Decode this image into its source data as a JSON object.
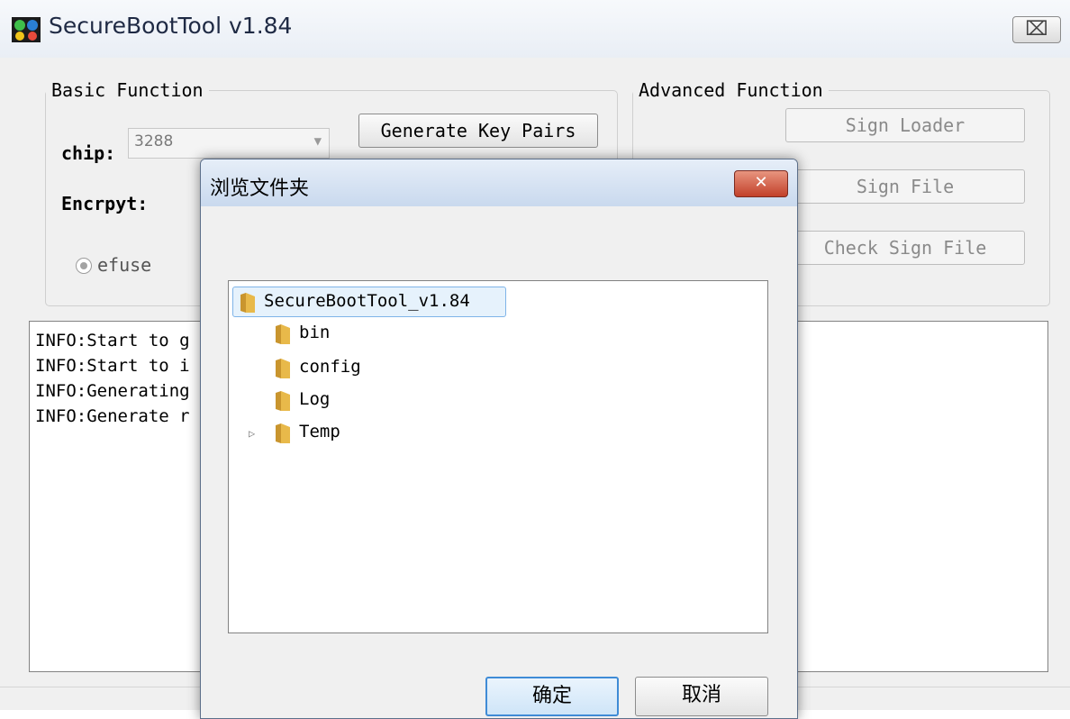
{
  "main_window": {
    "title": "SecureBootTool v1.84",
    "close_label": "⌧"
  },
  "basic": {
    "legend": "Basic Function",
    "chip_label": "chip:",
    "chip_value": "3288",
    "generate_label": "Generate Key Pairs",
    "encrypt_label": "Encrpyt:",
    "efuse_label": "efuse"
  },
  "advanced": {
    "legend": "Advanced Function",
    "sign_loader": "Sign Loader",
    "sign_file": "Sign File",
    "check_sign_file": "Check Sign File"
  },
  "log": {
    "lines": [
      "INFO:Start to g",
      "INFO:Start to i",
      "INFO:Generating",
      "INFO:Generate r"
    ]
  },
  "dialog": {
    "title": "浏览文件夹",
    "close_label": "✕",
    "tree": [
      {
        "label": "SecureBootTool_v1.84",
        "level": 0,
        "selected": true
      },
      {
        "label": "bin",
        "level": 1
      },
      {
        "label": "config",
        "level": 1
      },
      {
        "label": "Log",
        "level": 1
      },
      {
        "label": "Temp",
        "level": 1,
        "expandable": true
      }
    ],
    "ok_label": "确定",
    "cancel_label": "取消"
  },
  "colors": {
    "folder": "#e8b94a",
    "selection": "#e6f2fc",
    "dialog_close": "#c2402a"
  }
}
